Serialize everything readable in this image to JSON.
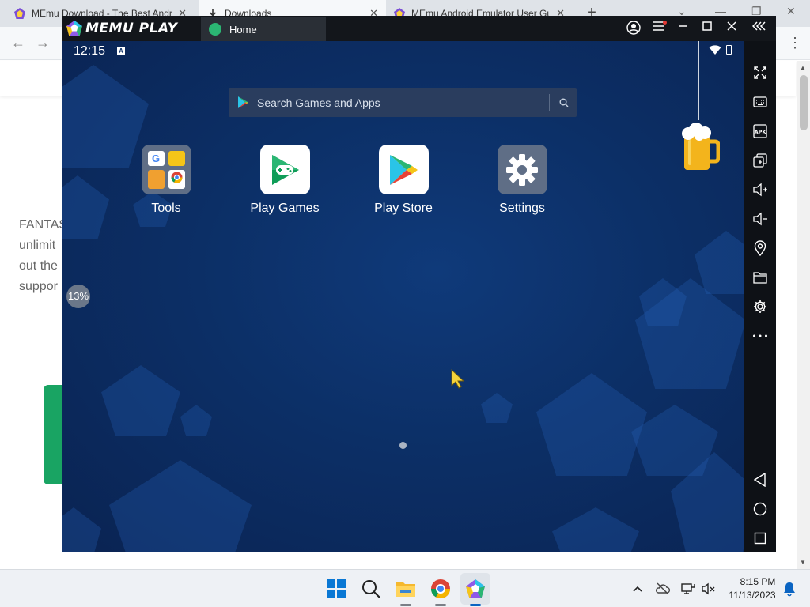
{
  "browser": {
    "tabs": [
      {
        "title": "MEmu Download - The Best Android Emulator for PC",
        "close": "✕"
      },
      {
        "title": "Downloads",
        "close": "✕"
      },
      {
        "title": "MEmu Android Emulator User Guide",
        "close": "✕"
      }
    ],
    "new_tab": "+",
    "page_text": [
      "FANTAS",
      "unlimit",
      "out the",
      "suppor"
    ]
  },
  "emulator": {
    "logo": "MEMU PLAY",
    "tab_label": "Home",
    "status": {
      "time": "12:15",
      "badge": "A"
    },
    "search": {
      "placeholder": "Search Games and Apps"
    },
    "apps": [
      {
        "label": "Tools",
        "icon": "tools-folder-icon"
      },
      {
        "label": "Play Games",
        "icon": "play-games-icon"
      },
      {
        "label": "Play Store",
        "icon": "play-store-icon"
      },
      {
        "label": "Settings",
        "icon": "settings-gear-icon"
      }
    ],
    "progress": "13%",
    "sidebar": [
      "fullscreen-icon",
      "keyboard-icon",
      "apk-icon",
      "multi-window-icon",
      "volume-up-icon",
      "volume-down-icon",
      "location-icon",
      "folder-icon",
      "settings-icon",
      "more-icon",
      "back-icon",
      "home-icon",
      "recents-icon"
    ]
  },
  "taskbar": {
    "time": "8:15 PM",
    "date": "11/13/2023"
  },
  "colors": {
    "emulator_bg": "#0c2f66",
    "accent_green": "#2bb673",
    "page_green": "#19a463"
  }
}
